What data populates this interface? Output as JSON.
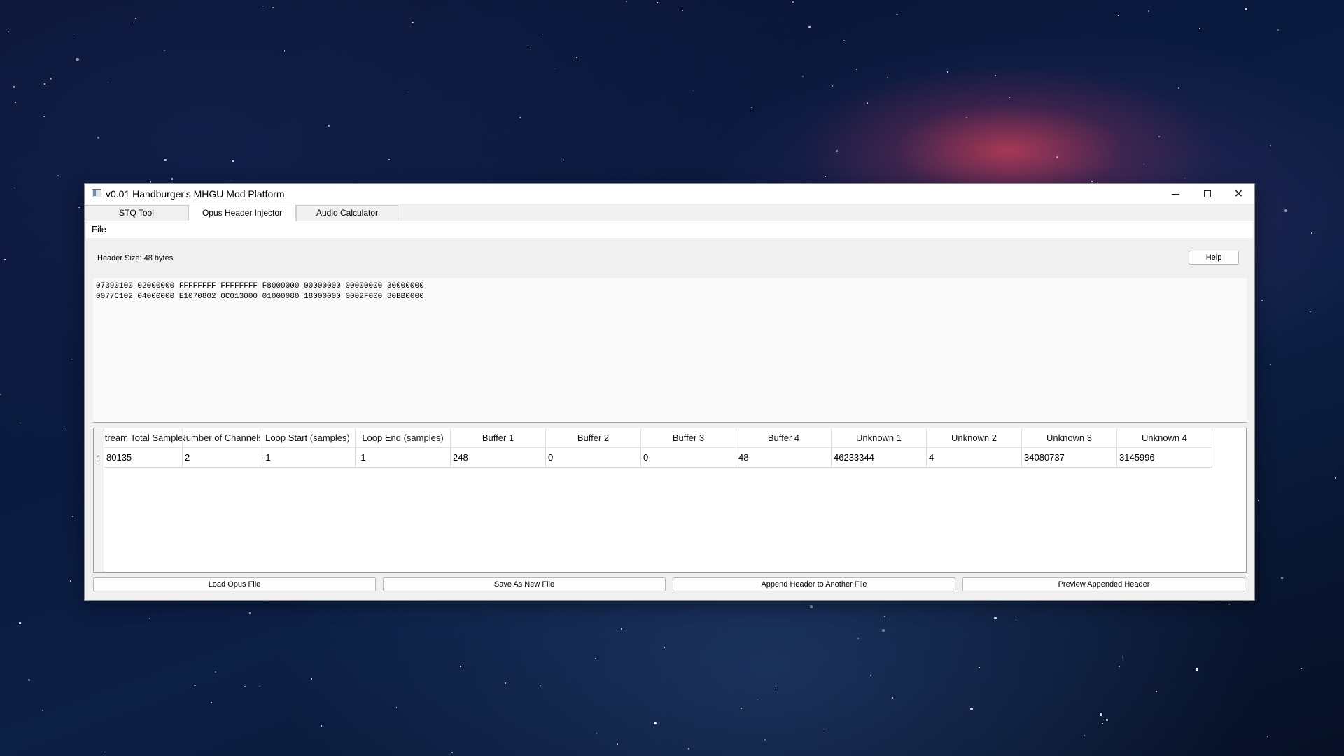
{
  "window": {
    "title": "v0.01 Handburger's MHGU Mod Platform"
  },
  "tabs": [
    {
      "label": "STQ Tool"
    },
    {
      "label": "Opus Header Injector"
    },
    {
      "label": "Audio Calculator"
    }
  ],
  "menu": {
    "file_label": "File"
  },
  "header_info": {
    "size_label": "Header Size: 48 bytes",
    "help_label": "Help"
  },
  "hex": {
    "lines": [
      "07390100 02000000 FFFFFFFF FFFFFFFF F8000000 00000000 00000000 30000000",
      "0077C102 04000000 E1070802 0C013000 01000080 18000000 0002F000 80BB0000"
    ]
  },
  "table": {
    "columns": [
      "Stream Total Samples",
      "Number of Channels",
      "Loop Start (samples)",
      "Loop End (samples)",
      "Buffer 1",
      "Buffer 2",
      "Buffer 3",
      "Buffer 4",
      "Unknown 1",
      "Unknown 2",
      "Unknown 3",
      "Unknown 4"
    ],
    "rows": [
      {
        "num": "1",
        "cells": [
          "80135",
          "2",
          "-1",
          "-1",
          "248",
          "0",
          "0",
          "48",
          "46233344",
          "4",
          "34080737",
          "3145996"
        ]
      }
    ]
  },
  "buttons": {
    "load": "Load Opus File",
    "save": "Save As New File",
    "append": "Append Header to Another File",
    "preview": "Preview Appended Header"
  },
  "colors": {
    "window_bg": "#f0f0f0",
    "titlebar_bg": "#ffffff"
  }
}
